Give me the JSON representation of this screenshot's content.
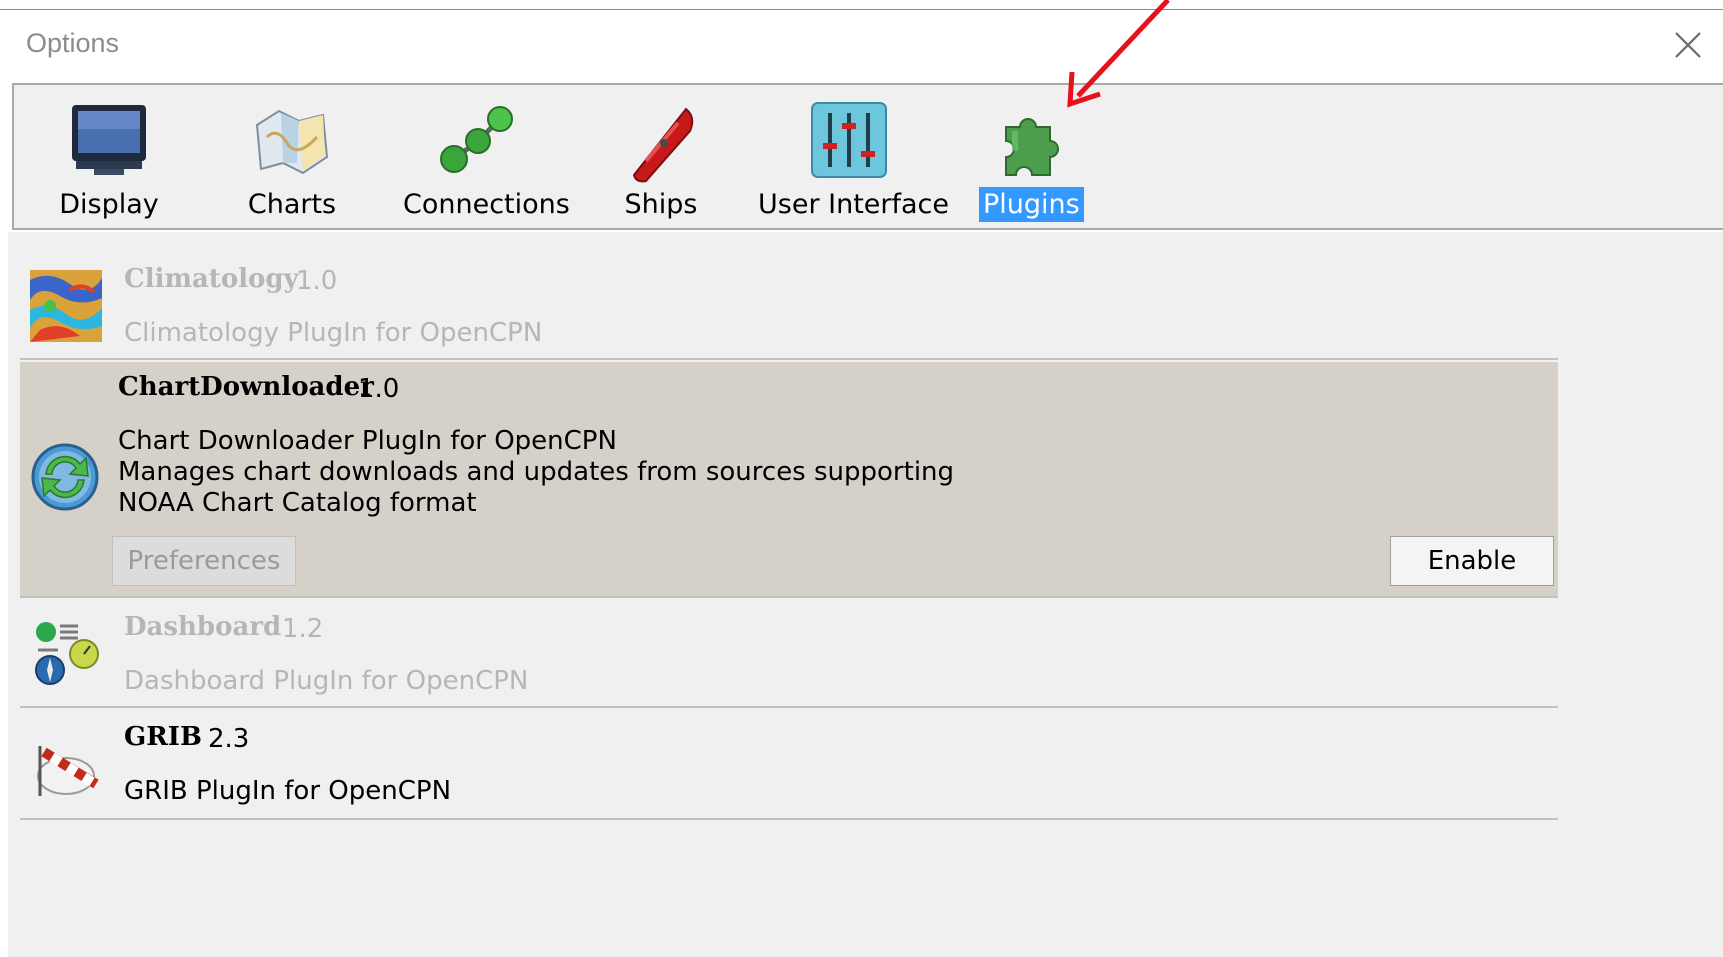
{
  "window": {
    "title": "Options"
  },
  "toolbar": {
    "items": [
      {
        "label": "Display",
        "icon": "display-icon"
      },
      {
        "label": "Charts",
        "icon": "charts-icon"
      },
      {
        "label": "Connections",
        "icon": "connections-icon"
      },
      {
        "label": "Ships",
        "icon": "ships-icon"
      },
      {
        "label": "User Interface",
        "icon": "user-interface-icon"
      },
      {
        "label": "Plugins",
        "icon": "plugins-icon",
        "selected": true
      }
    ]
  },
  "plugins": [
    {
      "name": "Climatology",
      "version": "1.0",
      "description": "Climatology PlugIn for OpenCPN",
      "enabled": false
    },
    {
      "name": "ChartDownloader",
      "version": "1.0",
      "description": "Chart Downloader PlugIn for OpenCPN\nManages chart downloads and updates from sources supporting\nNOAA Chart Catalog format",
      "enabled": false,
      "selected": true,
      "preferences_label": "Preferences",
      "enable_label": "Enable"
    },
    {
      "name": "Dashboard",
      "version": "1.2",
      "description": "Dashboard PlugIn for OpenCPN",
      "enabled": false
    },
    {
      "name": "GRIB",
      "version": "2.3",
      "description": "GRIB PlugIn for OpenCPN",
      "enabled": true
    }
  ],
  "colors": {
    "selection": "#3399ff",
    "selected_row": "#d5d1c9",
    "annotation_arrow": "#e8101a"
  }
}
